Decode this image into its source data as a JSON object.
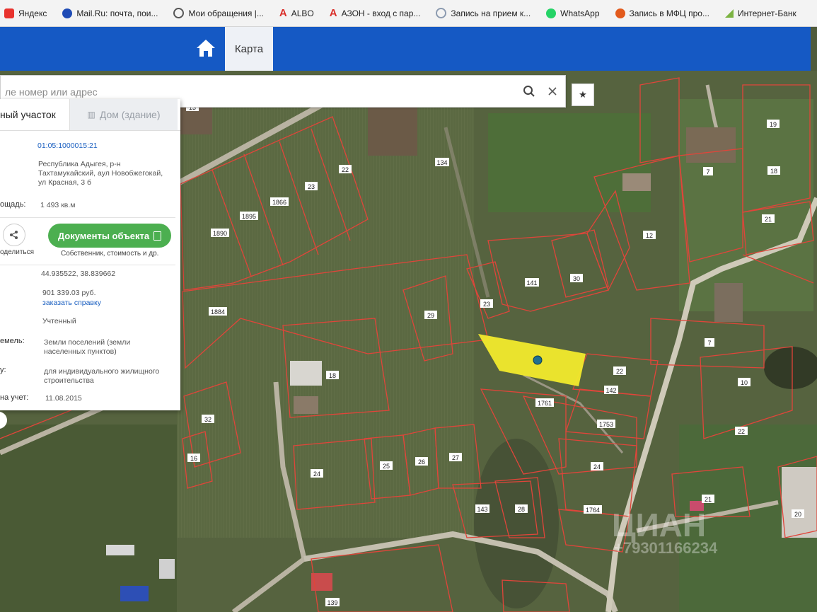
{
  "bookmarks": [
    {
      "label": "Яндекс",
      "color": "#e8322d"
    },
    {
      "label": "Mail.Ru: почта, пои...",
      "color": "#1e4bb5"
    },
    {
      "label": "Мои обращения |...",
      "color": "#555555"
    },
    {
      "label": "ALBO",
      "color": "#d9302b"
    },
    {
      "label": "АЗОН - вход с пар...",
      "color": "#d9302b"
    },
    {
      "label": "Запись на прием к...",
      "color": "#8c9bb0"
    },
    {
      "label": "WhatsApp",
      "color": "#25d366"
    },
    {
      "label": "Запись в МФЦ про...",
      "color": "#e25a1c"
    },
    {
      "label": "Интернет-Банк",
      "color": "#7cb342"
    }
  ],
  "header": {
    "tab_label": "Карта",
    "background": "#1559c4"
  },
  "search": {
    "placeholder": "ле номер или адрес"
  },
  "panel": {
    "tab_active": "ный участок",
    "tab_inactive": "Дом (здание)",
    "cadastral_number": "01:05:1000015:21",
    "address": "Республика Адыгея, р-н Тахтамукайский, аул Новобжегокай, ул Красная, 3 б",
    "area_label": "ощадь:",
    "area_value": "1 493 кв.м",
    "share_label": "оделиться",
    "docs_button": "Документы объекта",
    "docs_sub": "Собственник, стоимость и др.",
    "coords": "44.935522, 38.839662",
    "cost_value": "901 339.03 руб.",
    "cost_link": "заказать справку",
    "status_value": "Учтенный",
    "category_label": "емель:",
    "category_value": "Земли поселений (земли населенных пунктов)",
    "use_label": "у:",
    "use_value": "для индивидуального жилищного строительства",
    "reg_label": "на учет:",
    "reg_value": "11.08.2015"
  },
  "map": {
    "plot_labels": [
      "13",
      "19",
      "22",
      "23",
      "1866",
      "1895",
      "1890",
      "134",
      "7",
      "18",
      "12",
      "21",
      "141",
      "30",
      "1884",
      "29",
      "23",
      "7",
      "18",
      "22",
      "142",
      "10",
      "1761",
      "1753",
      "22",
      "32",
      "16",
      "24",
      "25",
      "26",
      "27",
      "143",
      "28",
      "24",
      "1764",
      "21",
      "20",
      "139"
    ],
    "watermark": "ЦИАН",
    "watermark_phone": "+79301166234",
    "highlight_color": "#f2ea2c"
  }
}
